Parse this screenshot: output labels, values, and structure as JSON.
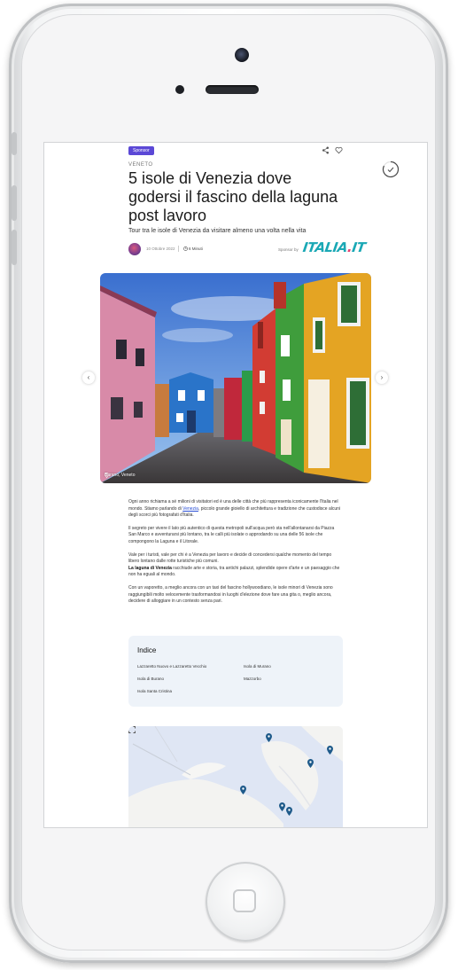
{
  "article": {
    "badge": "Sponsor",
    "region": "VENETO",
    "title": "5 isole di Venezia dove godersi il fascino della laguna post lavoro",
    "subtitle": "Tour tra le isole di Venezia da visitare almeno una volta nella vita",
    "date": "10 Ottobre 2022",
    "read_time": "6 Minuti",
    "sponsor_label": "Sponsor by",
    "sponsor_logo_main": "ITALIA",
    "sponsor_logo_dot": ".",
    "sponsor_logo_end": "IT",
    "hero_caption": "Burano, Veneto",
    "paragraphs": {
      "p1_a": "Ogni anno richiama a sé milioni di visitatori ed è una delle città che più rappresenta iconicamente l'Italia nel mondo. Stiamo parlando di ",
      "p1_link": "Venezia",
      "p1_b": ", piccolo grande gioiello di architettura e tradizione che custodisce alcuni degli scorci più fotografati d'Italia.",
      "p2": "Il segreto per vivere il lato più autentico di questa metropoli sull'acqua però sta nell'allontanarsi da Piazza San Marco e avventurarsi più lontano, tra le calli più isolate o approdando su una delle 56 isole che compongono la Laguna e il Litorale.",
      "p3_a": "Vale per i turisti, vale per chi è a Venezia per lavoro e decide di concedersi qualche momento del tempo libero lontano dalle rotte turistiche più comuni.",
      "p3_bold": "La laguna di Venezia",
      "p3_b": " racchiude arte e storia, tra antichi palazzi, splendide opere d'arte e un paesaggio che non ha eguali al mondo.",
      "p4": "Con un vaporetto, a meglio ancora con un taxi del fascino hollywoodiano, le isole minori di Venezia sono raggiungibili molto velocemente trasformandosi in luoghi d'elezione dove fare una gita o, meglio ancora, decidere di alloggiare in un contesto senza pari."
    }
  },
  "index": {
    "title": "Indice",
    "items": [
      "Lazzaretto Nuovo e Lazzaretto Vecchio",
      "Isola di Murano",
      "Isola di Burano",
      "Mazzorbo",
      "Isola Santa Cristina"
    ]
  },
  "nav": {
    "prev": "‹",
    "next": "›"
  },
  "icons": [
    "share-icon",
    "heart-icon",
    "reading-progress-icon",
    "clock-icon",
    "location-pin-icon",
    "map-pin-icon",
    "expand-icon"
  ],
  "colors": {
    "badge": "#5b48d6",
    "link": "#2a4fd6",
    "logo": "#1aa8b5",
    "logo_dot": "#e83f6f",
    "map_water": "#dfe6f4",
    "pin": "#1e5a8a"
  }
}
